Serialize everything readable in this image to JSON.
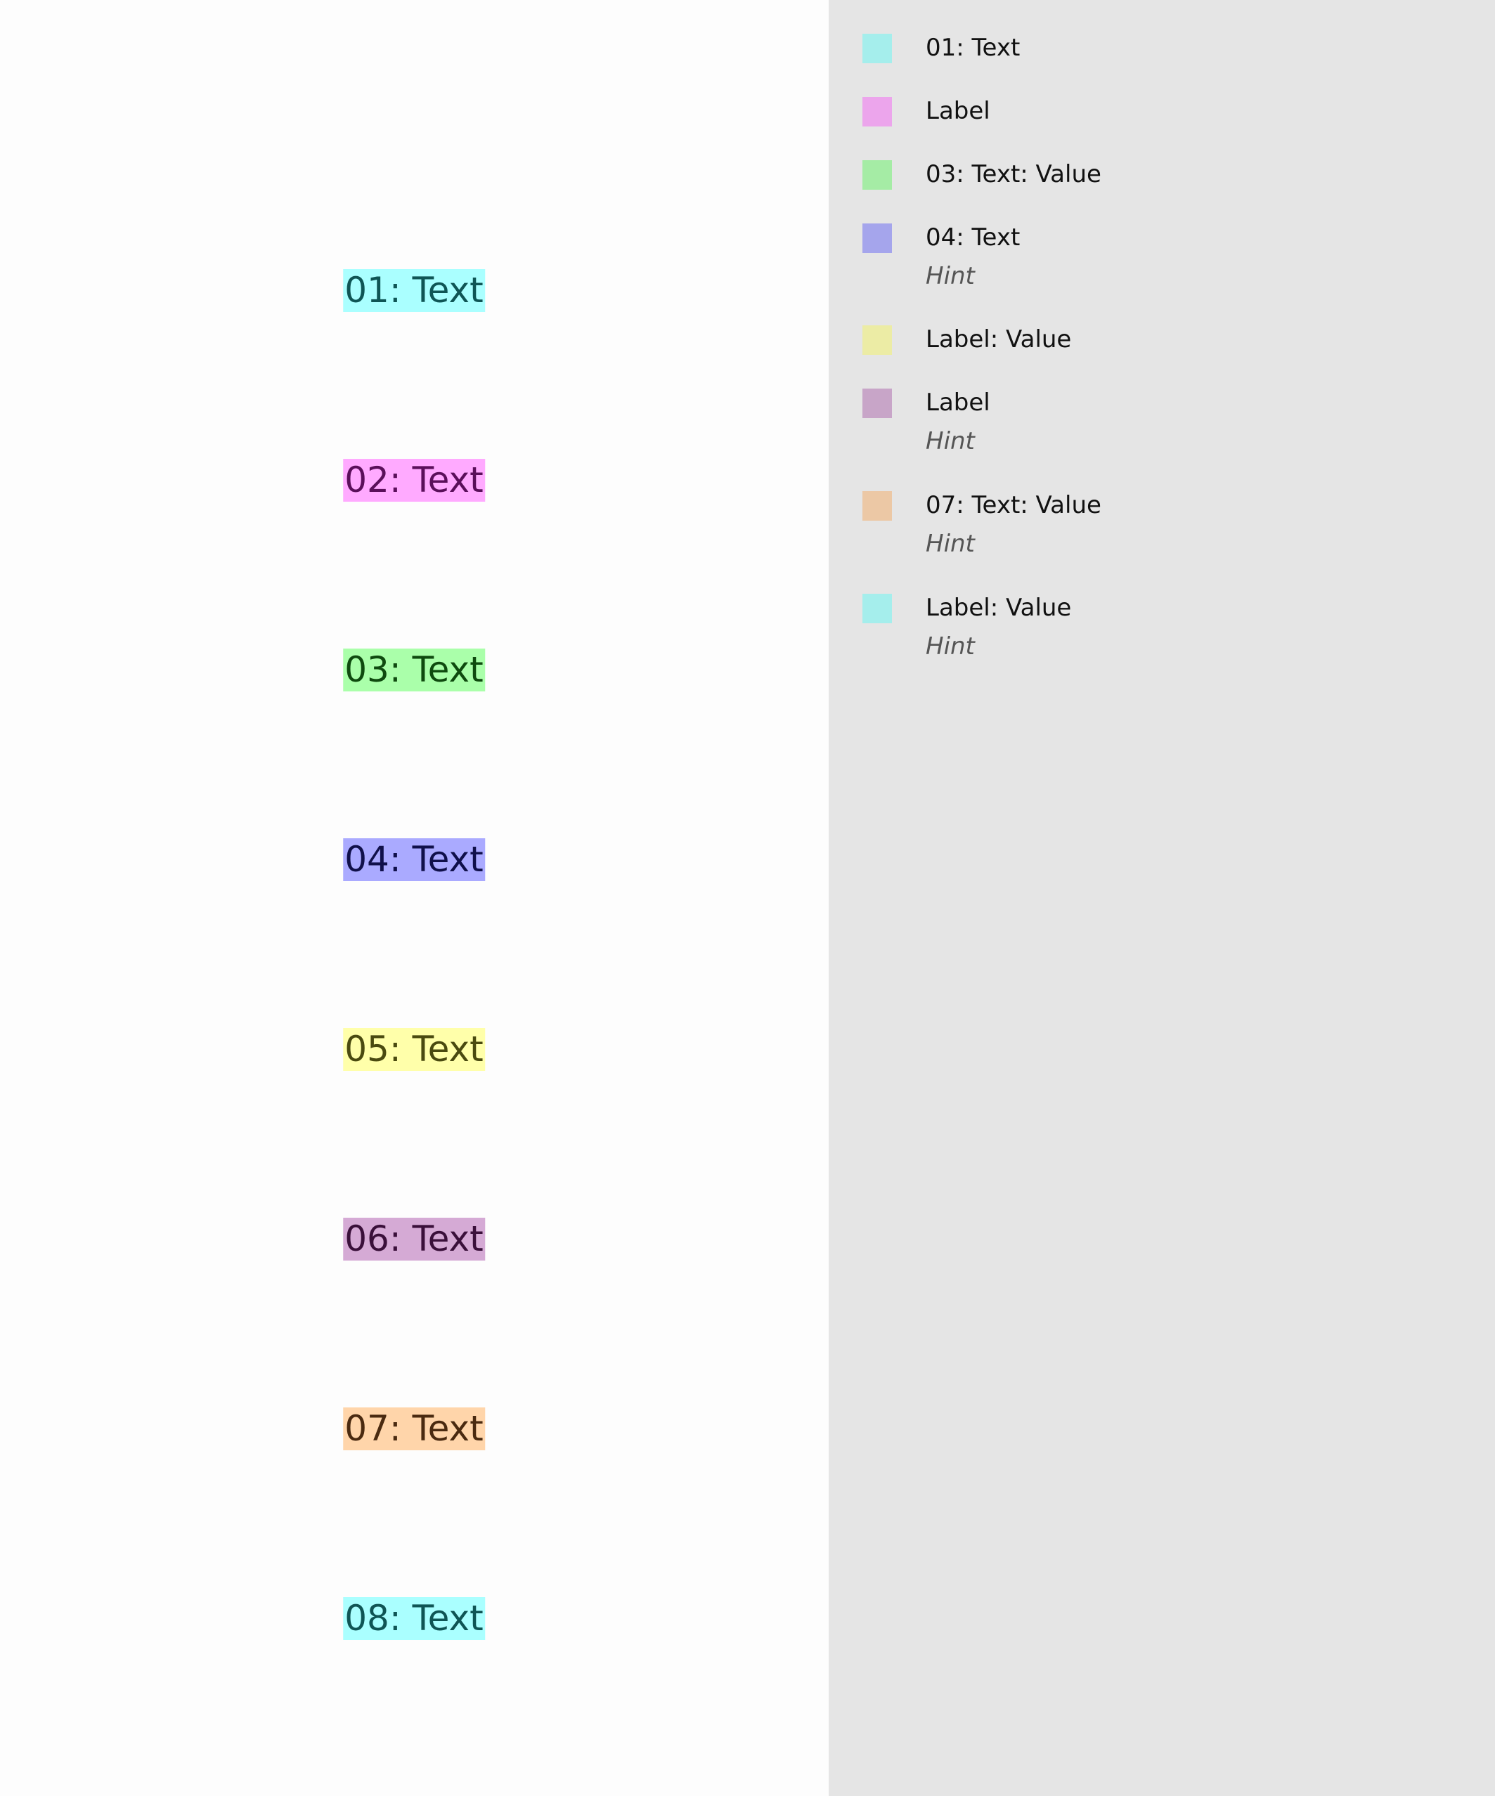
{
  "canvas": {
    "chips": [
      {
        "text": "01: Text",
        "bg": "#aaffff",
        "fg": "#0f5555"
      },
      {
        "text": "02: Text",
        "bg": "#ffaaff",
        "fg": "#5a0f5a"
      },
      {
        "text": "03: Text",
        "bg": "#aaffaa",
        "fg": "#0f4a0f"
      },
      {
        "text": "04: Text",
        "bg": "#aaaaff",
        "fg": "#10104a"
      },
      {
        "text": "05: Text",
        "bg": "#ffffaa",
        "fg": "#4a4a10"
      },
      {
        "text": "06: Text",
        "bg": "#d5aad5",
        "fg": "#3a103a"
      },
      {
        "text": "07: Text",
        "bg": "#ffd5aa",
        "fg": "#4a2a10"
      },
      {
        "text": "08: Text",
        "bg": "#aaffff",
        "fg": "#0f5555"
      }
    ]
  },
  "legend": {
    "items": [
      {
        "label": "01: Text",
        "hint": "",
        "color": "#a5eeec"
      },
      {
        "label": "Label",
        "hint": "",
        "color": "#eca5ec"
      },
      {
        "label": "03: Text: Value",
        "hint": "",
        "color": "#a5eca5"
      },
      {
        "label": "04: Text",
        "hint": "Hint",
        "color": "#a5a5ec"
      },
      {
        "label": "Label: Value",
        "hint": "",
        "color": "#ececa5"
      },
      {
        "label": "Label",
        "hint": "Hint",
        "color": "#c8a5c8"
      },
      {
        "label": "07: Text: Value",
        "hint": "Hint",
        "color": "#ecc8a5"
      },
      {
        "label": "Label: Value",
        "hint": "Hint",
        "color": "#a5eeec"
      }
    ]
  }
}
